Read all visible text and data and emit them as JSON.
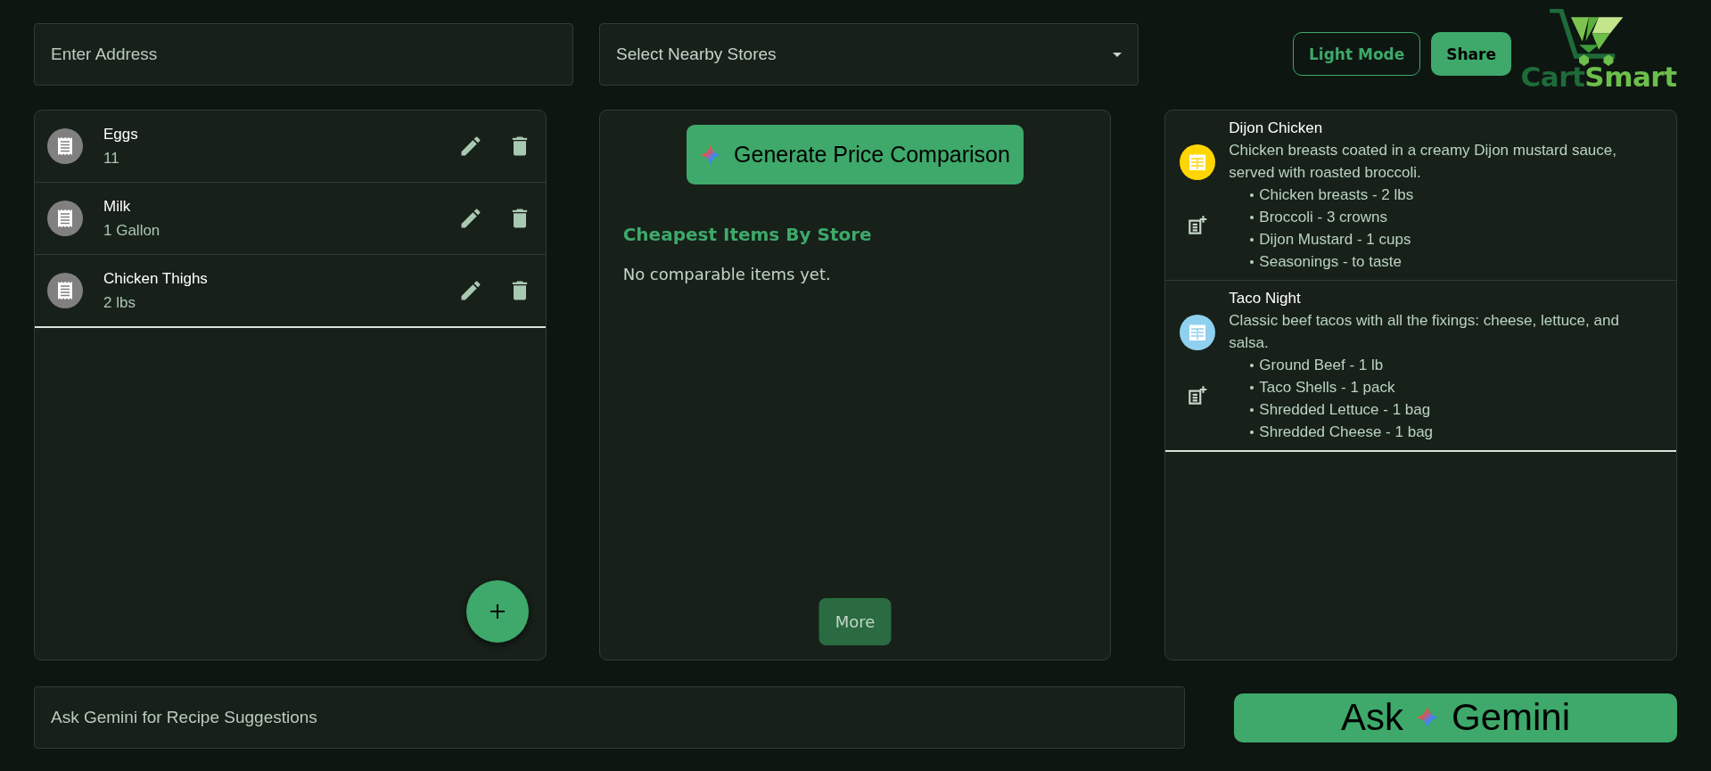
{
  "address_field": {
    "placeholder": "Enter Address"
  },
  "store_select": {
    "placeholder": "Select Nearby Stores"
  },
  "header_buttons": [
    {
      "label": "Light Mode",
      "kind": "outlined"
    },
    {
      "label": "Share",
      "kind": "filled"
    }
  ],
  "logo": {
    "text_1": "Cart",
    "text_2": "Smart"
  },
  "grocery_items": [
    {
      "name": "Eggs",
      "quantity": "11"
    },
    {
      "name": "Milk",
      "quantity": "1 Gallon"
    },
    {
      "name": "Chicken Thighs",
      "quantity": "2 lbs"
    }
  ],
  "comparison": {
    "button": "Generate Price Comparison",
    "heading": "Cheapest Items By Store",
    "empty_message": "No comparable items yet.",
    "more_button": "More"
  },
  "recipes": [
    {
      "title": "Dijon Chicken",
      "color": "#ffd600",
      "description": "Chicken breasts coated in a creamy Dijon mustard sauce, served with roasted broccoli.",
      "ingredients": [
        "Chicken breasts - 2 lbs",
        "Broccoli - 3 crowns",
        "Dijon Mustard - 1 cups",
        "Seasonings - to taste"
      ]
    },
    {
      "title": "Taco Night",
      "color": "#8fd0ee",
      "description": "Classic beef tacos with all the fixings: cheese, lettuce, and salsa.",
      "ingredients": [
        "Ground Beef - 1 lb",
        "Taco Shells - 1 pack",
        "Shredded Lettuce - 1 bag",
        "Shredded Cheese - 1 bag"
      ]
    }
  ],
  "gemini_field": {
    "placeholder": "Ask Gemini for Recipe Suggestions"
  },
  "ask_button": {
    "text_1": "Ask",
    "text_2": "Gemini"
  }
}
